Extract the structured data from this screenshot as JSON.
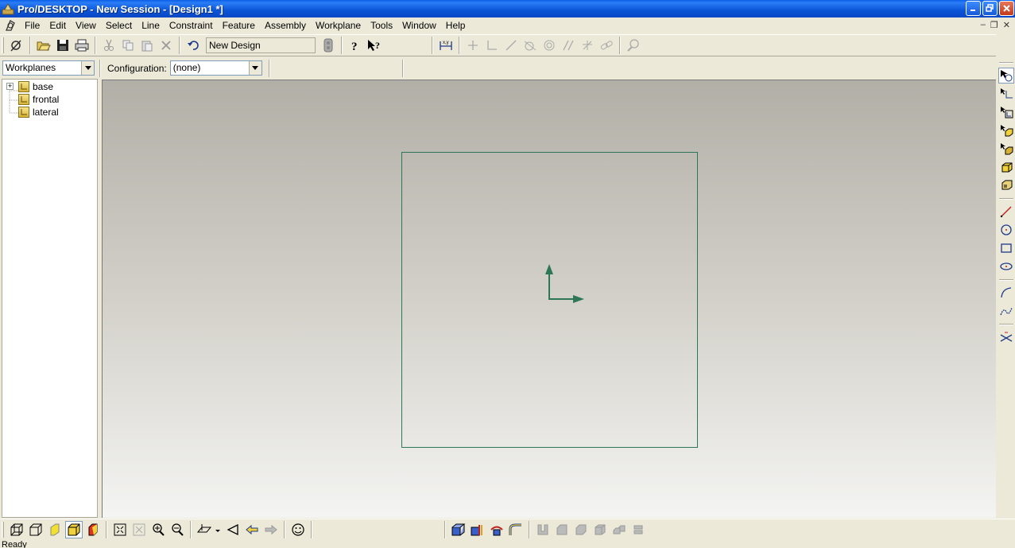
{
  "window": {
    "title": "Pro/DESKTOP - New Session - [Design1 *]"
  },
  "menu": {
    "items": [
      "File",
      "Edit",
      "View",
      "Select",
      "Line",
      "Constraint",
      "Feature",
      "Assembly",
      "Workplane",
      "Tools",
      "Window",
      "Help"
    ]
  },
  "toolbar": {
    "design_name": "New Design"
  },
  "browser": {
    "selector_value": "Workplanes",
    "config_label": "Configuration:",
    "config_value": "(none)",
    "tree": [
      {
        "label": "base",
        "expandable": true
      },
      {
        "label": "frontal",
        "expandable": false
      },
      {
        "label": "lateral",
        "expandable": false
      }
    ]
  },
  "status": {
    "text": "Ready"
  },
  "colors": {
    "titlebar": "#0a55d8",
    "workplane": "#2d7656",
    "viewport_top": "#b1afa6",
    "viewport_bottom": "#f4f4f2"
  }
}
